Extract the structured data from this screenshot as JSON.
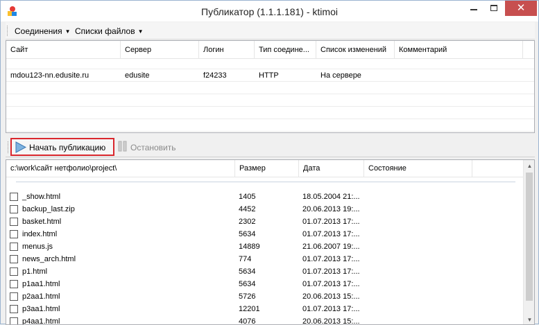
{
  "window": {
    "title": "Публикатор (1.1.1.181) - ktimoi"
  },
  "menu": {
    "connections": "Соединения",
    "file_lists": "Списки файлов"
  },
  "sites_grid": {
    "columns": [
      "Сайт",
      "Сервер",
      "Логин",
      "Тип соедине...",
      "Список изменений",
      "Комментарий"
    ],
    "rows": [
      {
        "site": "mdou123-nn.edusite.ru",
        "server": "edusite",
        "login": "f24233",
        "type": "HTTP",
        "changes": "На сервере",
        "comment": ""
      }
    ]
  },
  "toolbar": {
    "start_label": "Начать публикацию",
    "stop_label": "Остановить"
  },
  "files_grid": {
    "columns": [
      "c:\\work\\сайт нетфолио\\project\\",
      "Размер",
      "Дата",
      "Состояние"
    ],
    "rows": [
      {
        "name": "_show.html",
        "size": "1405",
        "date": "18.05.2004 21:..."
      },
      {
        "name": "backup_last.zip",
        "size": "4452",
        "date": "20.06.2013 19:..."
      },
      {
        "name": "basket.html",
        "size": "2302",
        "date": "01.07.2013 17:..."
      },
      {
        "name": "index.html",
        "size": "5634",
        "date": "01.07.2013 17:..."
      },
      {
        "name": "menus.js",
        "size": "14889",
        "date": "21.06.2007 19:..."
      },
      {
        "name": "news_arch.html",
        "size": "774",
        "date": "01.07.2013 17:..."
      },
      {
        "name": "p1.html",
        "size": "5634",
        "date": "01.07.2013 17:..."
      },
      {
        "name": "p1aa1.html",
        "size": "5634",
        "date": "01.07.2013 17:..."
      },
      {
        "name": "p2aa1.html",
        "size": "5726",
        "date": "20.06.2013 15:..."
      },
      {
        "name": "p3aa1.html",
        "size": "12201",
        "date": "01.07.2013 17:..."
      },
      {
        "name": "p4aa1.html",
        "size": "4076",
        "date": "20.06.2013 15:..."
      }
    ]
  },
  "colors": {
    "highlight_border": "#d9262c",
    "close_button": "#c74f4f"
  },
  "icons": {
    "app": "app-logo-icon",
    "start": "play-arrow-icon",
    "stop": "stop-icon"
  }
}
